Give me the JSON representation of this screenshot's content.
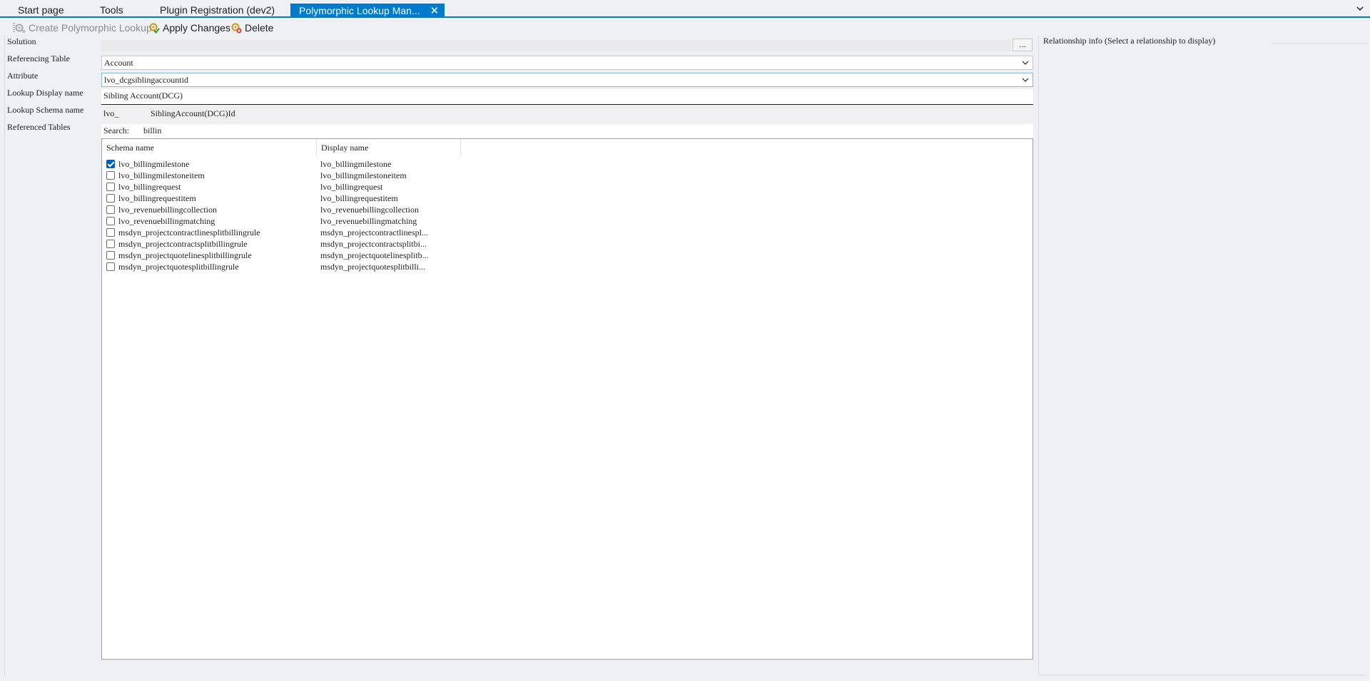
{
  "tabs": [
    {
      "label": "Start page"
    },
    {
      "label": "Tools"
    },
    {
      "label": "Plugin Registration (dev2)"
    },
    {
      "label": "Polymorphic Lookup Man...",
      "active": true
    }
  ],
  "toolbar": {
    "create_label": "Create Polymorphic Lookup",
    "apply_label": "Apply Changes",
    "delete_label": "Delete"
  },
  "form": {
    "solution_label": "Solution",
    "solution_value": "",
    "solution_browse": "...",
    "referencing_table_label": "Referencing Table",
    "referencing_table_value": "Account",
    "attribute_label": "Attribute",
    "attribute_value": "lvo_dcgsiblingaccountid",
    "lookup_display_label": "Lookup Display name",
    "lookup_display_value": "Sibling Account(DCG)",
    "lookup_schema_label": "Lookup Schema name",
    "lookup_schema_prefix": "lvo_",
    "lookup_schema_value": "SiblingAccount(DCG)Id",
    "referenced_tables_label": "Referenced Tables",
    "search_label": "Search:",
    "search_value": "billin"
  },
  "grid": {
    "columns": [
      "Schema name",
      "Display name"
    ],
    "rows": [
      {
        "checked": true,
        "schema": "lvo_billingmilestone",
        "display": "lvo_billingmilestone"
      },
      {
        "checked": false,
        "schema": "lvo_billingmilestoneitem",
        "display": "lvo_billingmilestoneitem"
      },
      {
        "checked": false,
        "schema": "lvo_billingrequest",
        "display": "lvo_billingrequest"
      },
      {
        "checked": false,
        "schema": "lvo_billingrequestitem",
        "display": "lvo_billingrequestitem"
      },
      {
        "checked": false,
        "schema": "lvo_revenuebillingcollection",
        "display": "lvo_revenuebillingcollection"
      },
      {
        "checked": false,
        "schema": "lvo_revenuebillingmatching",
        "display": "lvo_revenuebillingmatching"
      },
      {
        "checked": false,
        "schema": "msdyn_projectcontractlinesplitbillingrule",
        "display": "msdyn_projectcontractlinespl..."
      },
      {
        "checked": false,
        "schema": "msdyn_projectcontractsplitbillingrule",
        "display": "msdyn_projectcontractsplitbi..."
      },
      {
        "checked": false,
        "schema": "msdyn_projectquotelinesplitbillingrule",
        "display": "msdyn_projectquotelinesplitb..."
      },
      {
        "checked": false,
        "schema": "msdyn_projectquotesplitbillingrule",
        "display": "msdyn_projectquotesplitbilli..."
      }
    ]
  },
  "right_panel": {
    "title": "Relationship info (Select a relationship to display)"
  },
  "colors": {
    "accent": "#007acc",
    "checkbox": "#005fb8",
    "background": "#eef0f4"
  }
}
